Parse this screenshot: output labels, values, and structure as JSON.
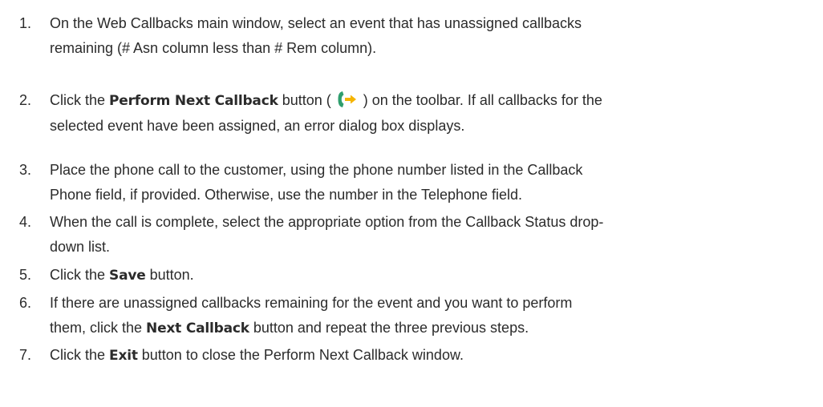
{
  "steps": [
    {
      "num": "1.",
      "line1": "On the Web Callbacks main window, select an event that has unassigned callbacks",
      "line2": "remaining (# Asn column less than # Rem column)."
    },
    {
      "num": "2.",
      "before": "Click the ",
      "bold": "Perform Next Callback",
      "mid": " button ( ",
      "icon": "phone-arrow-icon",
      "after": " ) on the toolbar. If all callbacks for the",
      "line2": "selected event have been assigned, an error dialog box displays."
    },
    {
      "num": "3.",
      "line1": "Place the phone call to the customer, using the phone number listed in the Callback",
      "line2": "Phone field, if provided. Otherwise, use the number in the Telephone field."
    },
    {
      "num": "4.",
      "line1": "When the call is complete, select the appropriate option from the Callback Status drop-",
      "line2": "down list."
    },
    {
      "num": "5.",
      "before": "Click the ",
      "bold": "Save",
      "after": " button."
    },
    {
      "num": "6.",
      "line1": "If there are unassigned callbacks remaining for the event and you want to perform",
      "before2": "them, click the ",
      "bold": "Next Callback",
      "after2": " button and repeat the three previous steps."
    },
    {
      "num": "7.",
      "before": "Click the ",
      "bold": "Exit",
      "after": " button to close the Perform Next Callback window."
    }
  ],
  "colors": {
    "text": "#2b2b2b",
    "phone_icon": "#2f9e6e",
    "arrow_icon": "#f5b400"
  }
}
